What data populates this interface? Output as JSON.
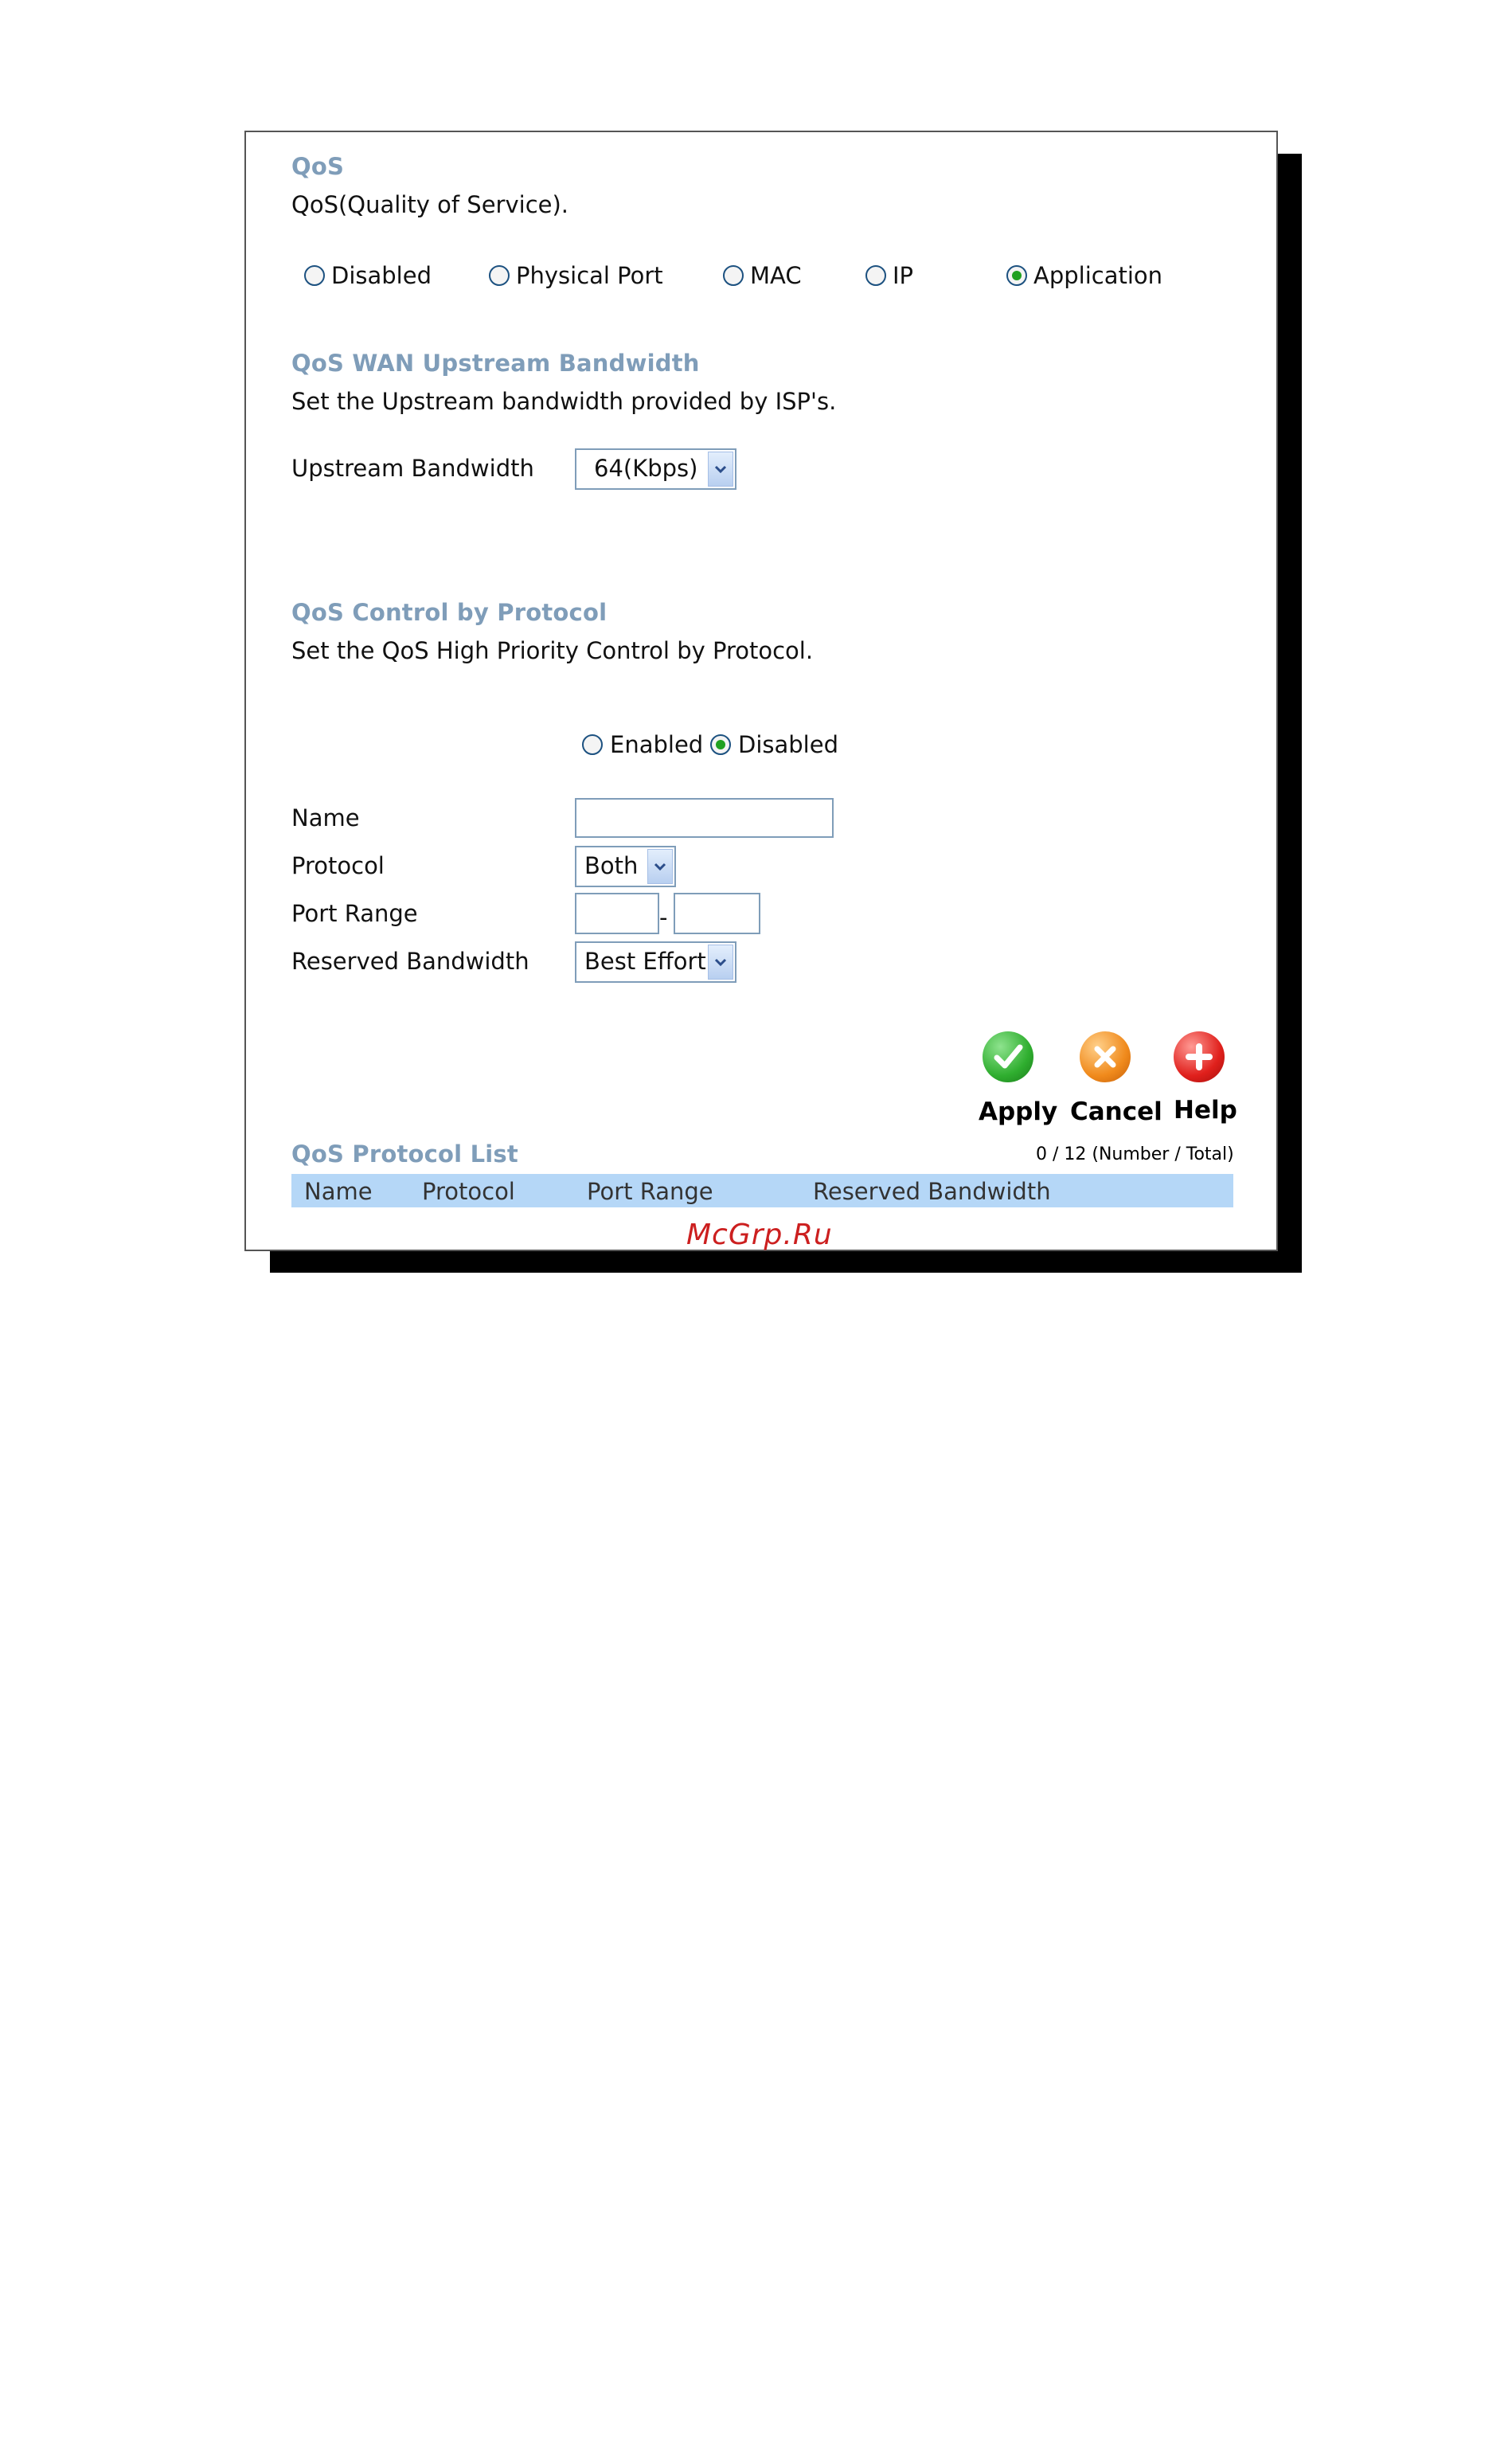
{
  "qos": {
    "title": "QoS",
    "description": "QoS(Quality of Service).",
    "mode_options": [
      {
        "label": "Disabled",
        "checked": false
      },
      {
        "label": "Physical Port",
        "checked": false
      },
      {
        "label": "MAC",
        "checked": false
      },
      {
        "label": "IP",
        "checked": false
      },
      {
        "label": "Application",
        "checked": true
      }
    ]
  },
  "upstream": {
    "title": "QoS WAN Upstream Bandwidth",
    "description": "Set the Upstream bandwidth provided by ISP's.",
    "bandwidth_label": "Upstream Bandwidth",
    "bandwidth_value": "64(Kbps)"
  },
  "protocol_control": {
    "title": "QoS Control by Protocol",
    "description": "Set the QoS High Priority Control by Protocol.",
    "enabled_label": "Enabled",
    "disabled_label": "Disabled",
    "enabled_checked": false,
    "disabled_checked": true,
    "name_label": "Name",
    "name_value": "",
    "protocol_label": "Protocol",
    "protocol_value": "Both",
    "port_range_label": "Port Range",
    "port_range_separator": "-",
    "port_from": "",
    "port_to": "",
    "reserved_label": "Reserved Bandwidth",
    "reserved_value": "Best Effort"
  },
  "actions": {
    "apply": "Apply",
    "cancel": "Cancel",
    "help": "Help"
  },
  "list": {
    "title": "QoS Protocol List",
    "count": "0 / 12 (Number / Total)",
    "columns": [
      "Name",
      "Protocol",
      "Port Range",
      "Reserved Bandwidth"
    ]
  },
  "watermark": "McGrp.Ru",
  "colors": {
    "heading": "#7f9db9",
    "list_header_bg": "#b5d7f7",
    "apply_green": "#2fae2f",
    "cancel_orange": "#f08a1c",
    "help_red": "#e0201c"
  }
}
